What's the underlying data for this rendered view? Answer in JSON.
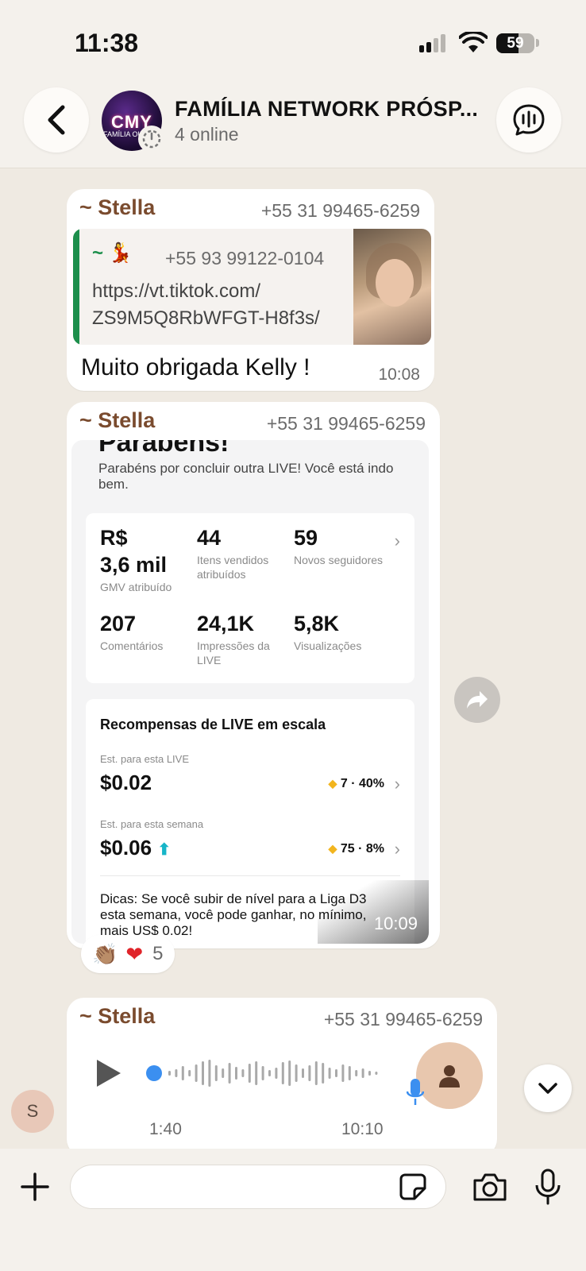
{
  "status_bar": {
    "time": "11:38",
    "battery": "59",
    "battery_level": 0.59
  },
  "header": {
    "group_name": "FAMÍLIA NETWORK PRÓSP...",
    "online": "4 online",
    "avatar_text": "CMY",
    "avatar_sub": "FAMÍLIA OUTLET",
    "icons": [
      "back-icon",
      "timer-icon",
      "voice-chat-icon"
    ]
  },
  "messages": [
    {
      "sender": "~ Stella",
      "phone": "+55 31 99465-6259",
      "quote": {
        "author": "~ 💃",
        "phone": "+55 93 99122-0104",
        "text": "https://vt.tiktok.com/\nZS9M5Q8RbWFGT-H8f3s/"
      },
      "text": "Muito obrigada Kelly !",
      "time": "10:08"
    },
    {
      "sender": "~ Stella",
      "phone": "+55 31 99465-6259",
      "time": "10:09",
      "image": {
        "title": "Parabéns!",
        "subtitle": "Parabéns por concluir outra LIVE! Você está indo bem.",
        "stats": [
          {
            "value": "R$\n3,6 mil",
            "label": "GMV atribuído"
          },
          {
            "value": "44",
            "label": "Itens vendidos atribuídos"
          },
          {
            "value": "59",
            "label": "Novos seguidores"
          },
          {
            "value": "207",
            "label": "Comentários"
          },
          {
            "value": "24,1K",
            "label": "Impressões da LIVE"
          },
          {
            "value": "5,8K",
            "label": "Visualizações"
          }
        ],
        "rewards": {
          "title": "Recompensas de LIVE em escala",
          "live_label": "Est. para esta LIVE",
          "live_amount": "$0.02",
          "live_right": "7 · 40%",
          "week_label": "Est. para esta semana",
          "week_amount": "$0.06",
          "week_right": "75 · 8%",
          "tips": "Dicas: Se você subir de nível para a Liga D3 esta semana, você pode ganhar, no mínimo, mais US$ 0.02!"
        }
      },
      "reactions": {
        "emoji_1": "👏🏽",
        "emoji_2": "❤",
        "count": "5"
      }
    },
    {
      "sender": "~ Stella",
      "phone": "+55 31 99465-6259",
      "voice_duration": "1:40",
      "time": "10:10"
    }
  ],
  "side_avatar": "S",
  "colors": {
    "background": "#efeae2",
    "sender": "#7a4b2e",
    "quote_accent": "#1d8f4c",
    "heart": "#e0242a",
    "play_dot": "#3b8ff0"
  }
}
